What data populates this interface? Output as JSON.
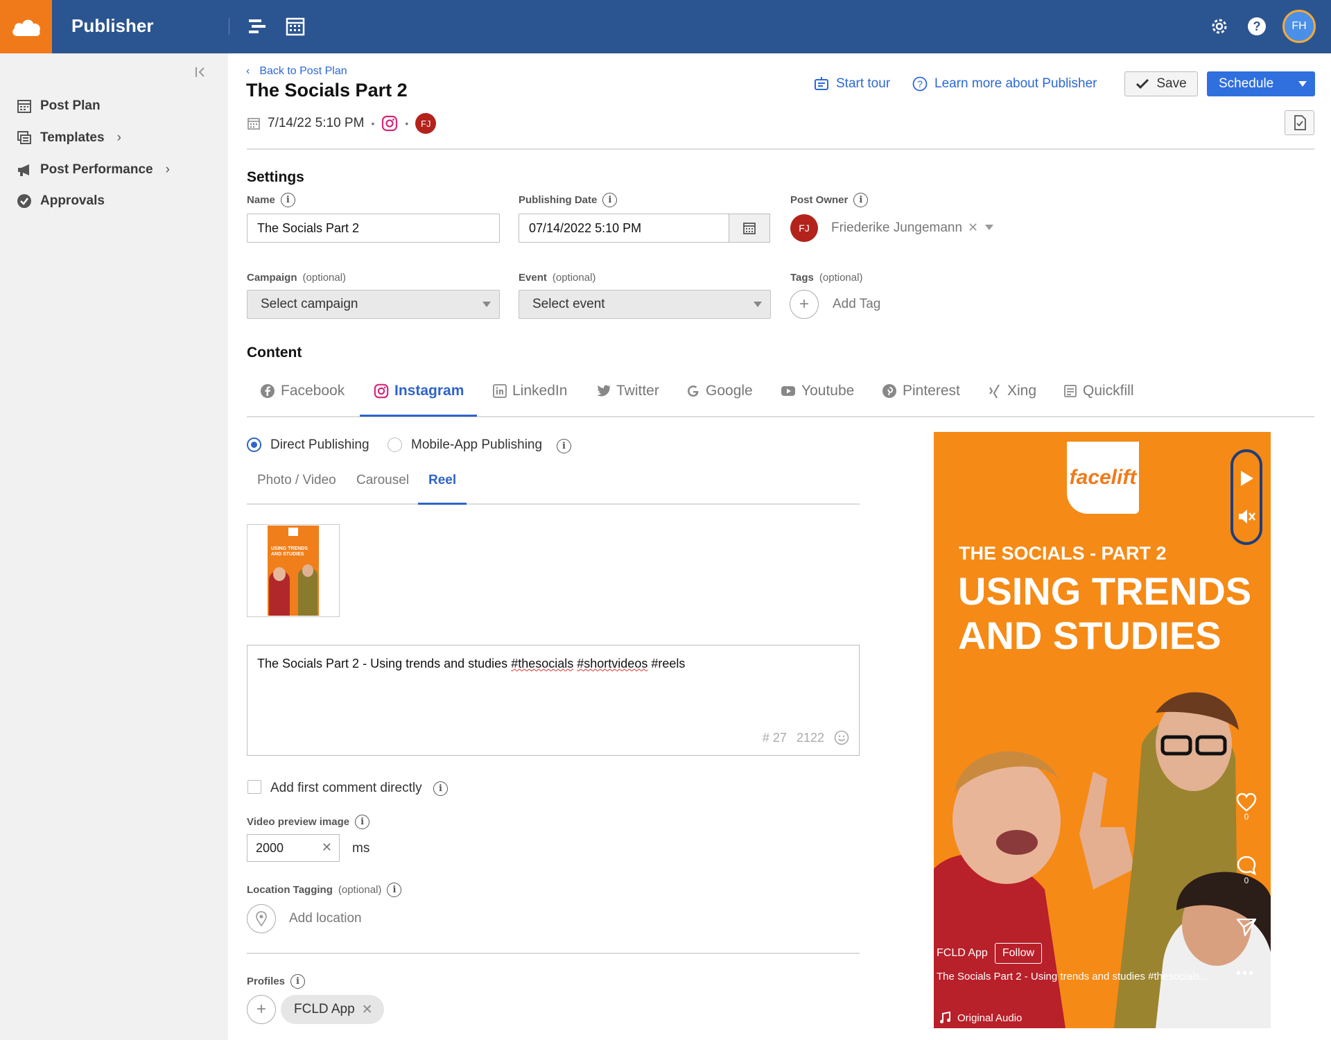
{
  "app": {
    "title": "Publisher",
    "user_initials": "FH"
  },
  "sidebar": {
    "items": [
      {
        "label": "Post Plan",
        "icon": "calendar-icon",
        "has_chevron": false
      },
      {
        "label": "Templates",
        "icon": "templates-icon",
        "has_chevron": true
      },
      {
        "label": "Post Performance",
        "icon": "megaphone-icon",
        "has_chevron": true
      },
      {
        "label": "Approvals",
        "icon": "approval-check-icon",
        "has_chevron": false
      }
    ]
  },
  "header": {
    "back_label": "Back to Post Plan",
    "title": "The Socials Part 2",
    "datetime": "7/14/22 5:10 PM",
    "owner_initials": "FJ",
    "start_tour": "Start tour",
    "learn_more": "Learn more about Publisher",
    "save_label": "Save",
    "schedule_label": "Schedule"
  },
  "settings": {
    "title": "Settings",
    "name_label": "Name",
    "name_value": "The Socials Part 2",
    "date_label": "Publishing Date",
    "date_value": "07/14/2022 5:10 PM",
    "owner_label": "Post Owner",
    "owner_initials": "FJ",
    "owner_name": "Friederike Jungemann",
    "campaign_label": "Campaign",
    "campaign_optional": "(optional)",
    "campaign_placeholder": "Select campaign",
    "event_label": "Event",
    "event_optional": "(optional)",
    "event_placeholder": "Select event",
    "tags_label": "Tags",
    "tags_optional": "(optional)",
    "add_tag": "Add Tag"
  },
  "content": {
    "title": "Content",
    "tabs": [
      {
        "label": "Facebook",
        "icon": "facebook-icon"
      },
      {
        "label": "Instagram",
        "icon": "instagram-icon",
        "active": true
      },
      {
        "label": "LinkedIn",
        "icon": "linkedin-icon"
      },
      {
        "label": "Twitter",
        "icon": "twitter-icon"
      },
      {
        "label": "Google",
        "icon": "google-icon"
      },
      {
        "label": "Youtube",
        "icon": "youtube-icon"
      },
      {
        "label": "Pinterest",
        "icon": "pinterest-icon"
      },
      {
        "label": "Xing",
        "icon": "xing-icon"
      },
      {
        "label": "Quickfill",
        "icon": "quickfill-icon"
      }
    ],
    "publishing_modes": [
      "Direct Publishing",
      "Mobile-App Publishing"
    ],
    "selected_mode": "Direct Publishing",
    "subtabs": [
      "Photo / Video",
      "Carousel",
      "Reel"
    ],
    "active_subtab": "Reel",
    "caption_prefix": "The Socials Part 2 - Using trends and studies ",
    "caption_tag1": "#thesocials",
    "caption_tag2": "#shortvideos",
    "caption_tag3": "#reels",
    "hashtag_count": "# 27",
    "chars_left": "2122",
    "first_comment_label": "Add first comment directly",
    "video_preview_label": "Video preview image",
    "video_preview_value": "2000",
    "video_preview_unit": "ms",
    "location_label": "Location Tagging",
    "location_optional": "(optional)",
    "add_location": "Add location",
    "profiles_label": "Profiles",
    "profile_chip": "FCLD App"
  },
  "preview": {
    "logo_text": "facelift",
    "subtitle": "THE SOCIALS - PART 2",
    "headline_line1": "USING TRENDS",
    "headline_line2": "AND STUDIES",
    "account": "FCLD App",
    "follow": "Follow",
    "caption": "The Socials Part 2 - Using trends and studies #thesocials...",
    "audio": "Original Audio",
    "likes": "0",
    "comments": "0",
    "thumb_title_line1": "USING TRENDS",
    "thumb_title_line2": "AND STUDIES",
    "colors": {
      "accent": "#f58a16",
      "brand_blue": "#2b5591"
    }
  }
}
